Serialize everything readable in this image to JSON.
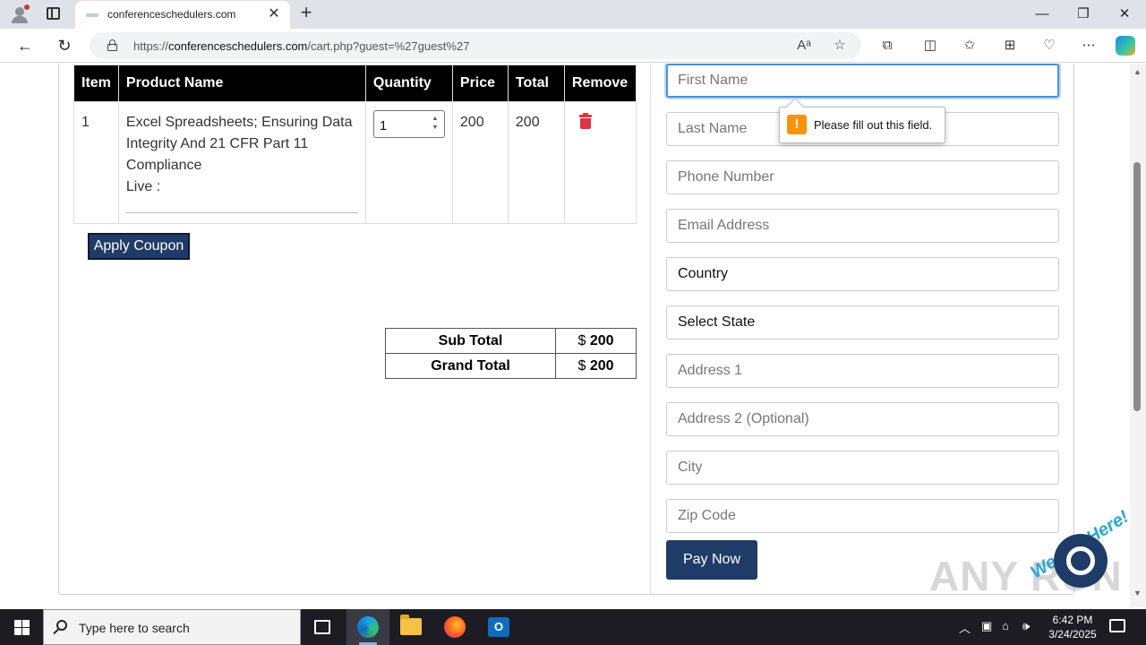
{
  "browser": {
    "tab_title": "conferenceschedulers.com",
    "url_prefix": "https://",
    "url_domain": "conferenceschedulers.com",
    "url_path": "/cart.php?guest=%27guest%27",
    "icons": [
      "profile-icon",
      "tab-actions-icon",
      "close-icon",
      "new-tab-icon",
      "back-icon",
      "refresh-icon",
      "lock-icon",
      "read-aloud-icon",
      "favorite-star-icon",
      "extensions-icon",
      "split-screen-icon",
      "favorites-icon",
      "collections-icon",
      "performance-icon",
      "more-icon",
      "copilot-icon"
    ]
  },
  "cart": {
    "headers": [
      "Item",
      "Product Name",
      "Quantity",
      "Price",
      "Total",
      "Remove"
    ],
    "row": {
      "item": "1",
      "product_line1": "Excel Spreadsheets; Ensuring Data",
      "product_line2": "Integrity And 21 CFR Part 11",
      "product_line3": "Compliance",
      "product_line4": "Live :",
      "quantity": "1",
      "price": "200",
      "total": "200"
    },
    "apply_coupon": "Apply Coupon",
    "sub_total_label": "Sub Total",
    "sub_total_currency": "$",
    "sub_total_value": "200",
    "grand_total_label": "Grand Total",
    "grand_total_currency": "$",
    "grand_total_value": "200"
  },
  "form": {
    "first_name": "First Name",
    "last_name": "Last Name",
    "phone": "Phone Number",
    "email": "Email Address",
    "country": "Country",
    "state": "Select State",
    "address1": "Address 1",
    "address2": "Address 2 (Optional)",
    "city": "City",
    "zip": "Zip Code",
    "pay_now": "Pay Now",
    "validation_message": "Please fill out this field."
  },
  "overlay": {
    "watermark": "ANY RUN",
    "chat_badge": "We Are Here!"
  },
  "taskbar": {
    "search_placeholder": "Type here to search",
    "time": "6:42 PM",
    "date": "3/24/2025"
  },
  "colors": {
    "header_bg": "#000000",
    "button_navy": "#1f3c68",
    "remove_red": "#dc3545",
    "focus_blue": "#4a90d9",
    "warning_orange": "#f7930a"
  }
}
